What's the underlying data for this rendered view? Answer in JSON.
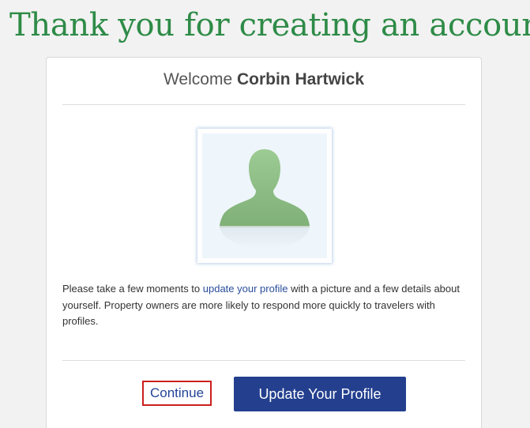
{
  "page": {
    "title": "Thank you for creating an account"
  },
  "welcome": {
    "greeting": "Welcome",
    "user_name": "Corbin Hartwick"
  },
  "avatar": {
    "icon": "default-user-silhouette-icon",
    "colors": {
      "silhouette": "#8fbe86",
      "background": "#eef5fb"
    }
  },
  "message": {
    "before_link": "Please take a few moments to ",
    "link_text": "update your profile",
    "after_link": " with a picture and a few details about yourself. Property owners are more likely to respond more quickly to travelers with profiles."
  },
  "actions": {
    "continue_label": "Continue",
    "update_profile_label": "Update Your Profile"
  },
  "colors": {
    "title": "#2e8b47",
    "primary_button": "#233f8e",
    "link": "#2a4d9b",
    "highlight_border": "#cc1f1f"
  }
}
